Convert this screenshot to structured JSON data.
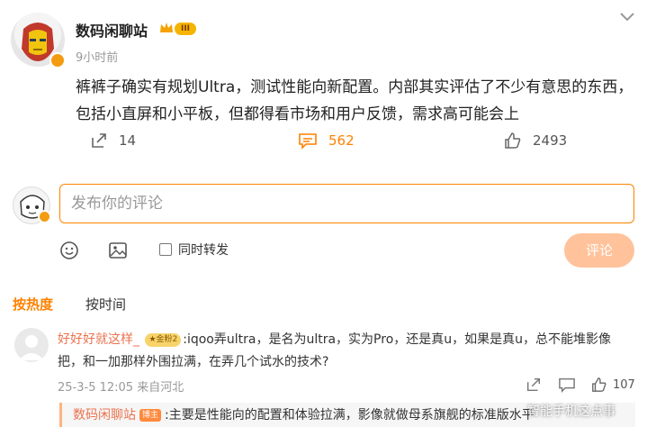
{
  "post": {
    "author": "数码闲聊站",
    "level_badge": "III",
    "time": "9小时前",
    "text": "裤裤子确实有规划Ultra，测试性能向新配置。内部其实评估了不少有意思的东西，包括小直屏和小平板，但都得看市场和用户反馈，需求高可能会上",
    "reposts": "14",
    "comments": "562",
    "likes": "2493"
  },
  "composer": {
    "placeholder": "发布你的评论",
    "repost_label": "同时转发",
    "submit_label": "评论"
  },
  "tabs": [
    {
      "label": "按热度"
    },
    {
      "label": "按时间"
    }
  ],
  "comment": {
    "user": "好好好就这样_",
    "badge": "★金粉2",
    "text": ":iqoo弄ultra，是名为ultra，实为Pro，还是真u，如果是真u，总不能堆影像把，和一加那样外围拉满，在弄几个试水的技术?",
    "meta": "25-3-5 12:05 来自河北",
    "likes": "107"
  },
  "reply": {
    "user": "数码闲聊站",
    "badge": "博主",
    "text": ":主要是性能向的配置和体验拉满，影像就做母系旗舰的标准版水平"
  },
  "watermark": "智能手机这点事",
  "colors": {
    "accent": "#ff8200",
    "submit_disabled": "#ffc29a",
    "username": "#eb7350"
  }
}
